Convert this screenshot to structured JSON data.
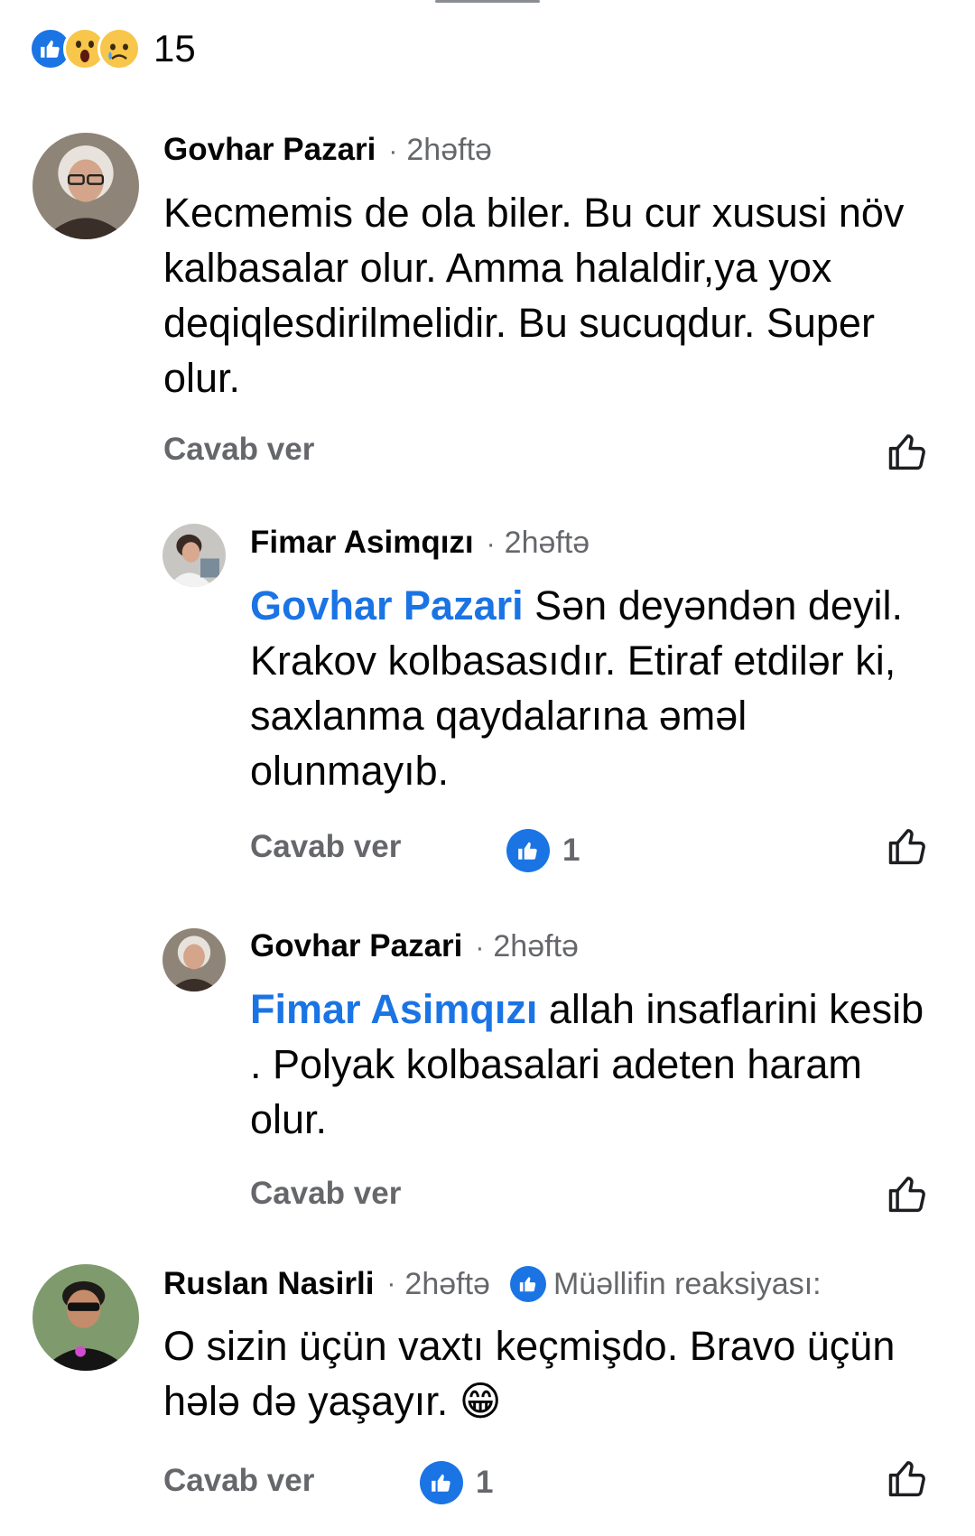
{
  "reactions": {
    "icons": [
      "like-icon",
      "wow-icon",
      "sad-icon"
    ],
    "count": "15"
  },
  "colors": {
    "accent": "#1b74e4",
    "secondary_text": "#65676b"
  },
  "comments": [
    {
      "author": "Govhar Pazari",
      "time": "2həftə",
      "text": "Kecmemis de ola biler. Bu cur xususi növ kalbasalar olur. Amma halaldir,ya yox deqiqlesdirilmelidir. Bu sucuqdur. Super olur.",
      "reply_label": "Cavab ver"
    },
    {
      "author": "Fimar Asimqızı",
      "time": "2həftə",
      "mention": "Govhar Pazari",
      "text": " Sən deyəndən deyil. Krakov kolbasasıdır. Etiraf etdilər ki, saxlanma qaydalarına əməl olunmayıb.",
      "reply_label": "Cavab ver",
      "like_count": "1"
    },
    {
      "author": "Govhar Pazari",
      "time": "2həftə",
      "mention": "Fimar Asimqızı",
      "text": " allah insaflarini kesib  . Polyak kolbasalari adeten haram olur.",
      "reply_label": "Cavab ver"
    },
    {
      "author": "Ruslan Nasirli",
      "time": "2həftə",
      "author_reaction": "Müəllifin reaksiyası:",
      "text": "O sizin üçün vaxtı keçmişdo. Bravo üçün hələ də yaşayır. 😁",
      "reply_label": "Cavab ver",
      "like_count": "1"
    }
  ],
  "dot_separator": "·"
}
